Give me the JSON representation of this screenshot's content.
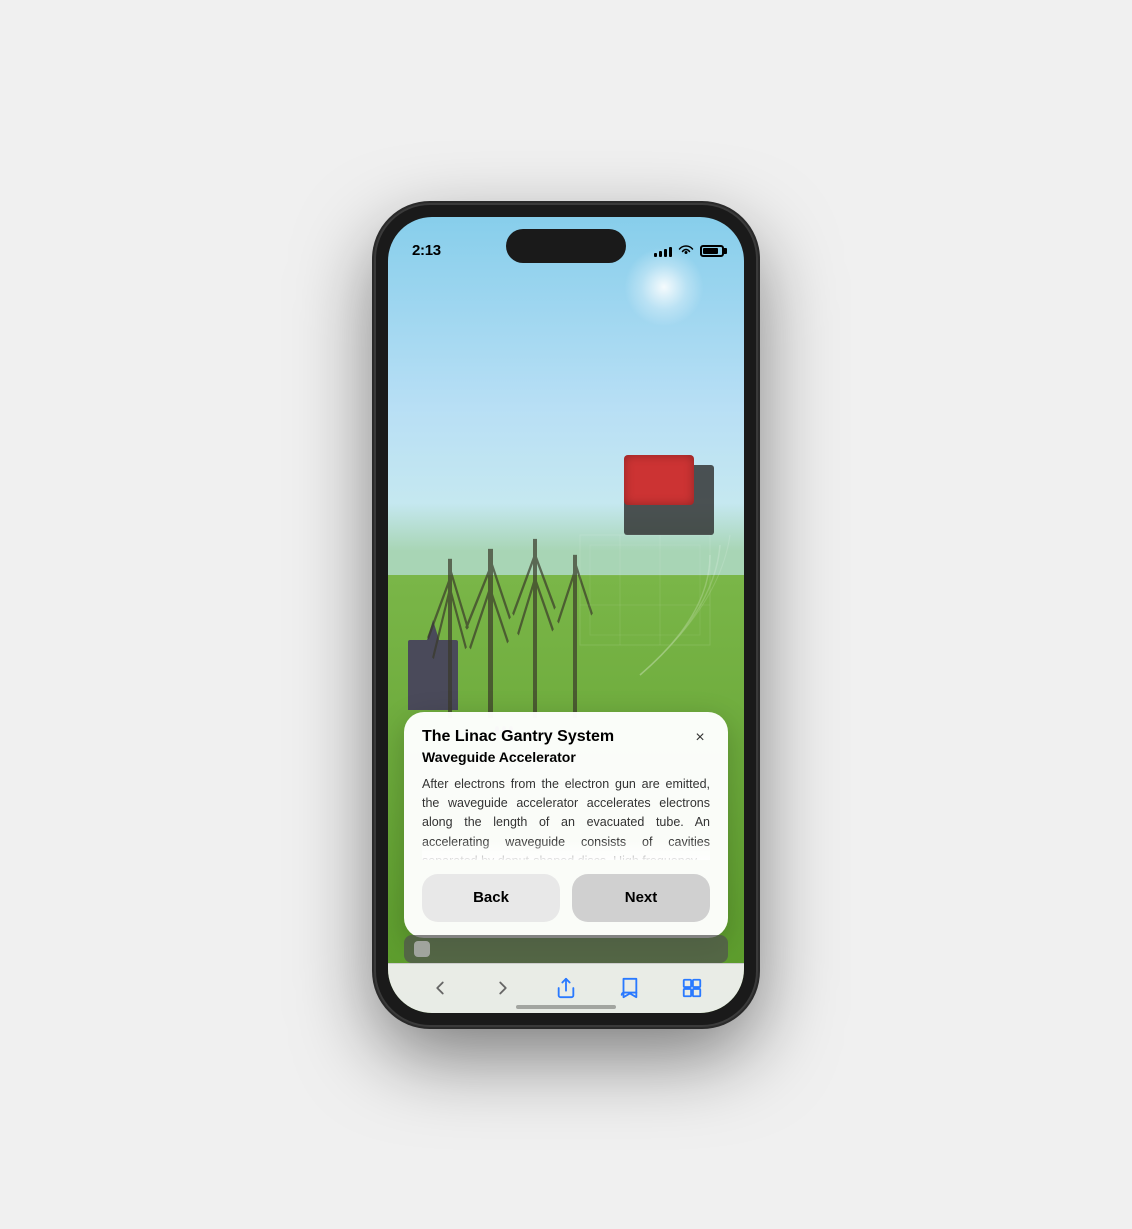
{
  "phone": {
    "status_bar": {
      "time": "2:13",
      "signal_label": "signal",
      "wifi_label": "wifi",
      "battery_label": "battery"
    },
    "ar_scene": {
      "title": "AR Scene",
      "description": "Outdoor AR visualization of Linac Gantry System"
    },
    "info_panel": {
      "title": "The Linac Gantry System",
      "subtitle": "Waveguide Accelerator",
      "body_text": "After electrons from the electron gun are emitted, the waveguide accelerator accelerates electrons along the length of an evacuated tube. An accelerating waveguide consists of cavities separated by donut-shaped discs. High frequency",
      "close_label": "×"
    },
    "nav_buttons": {
      "back_label": "Back",
      "next_label": "Next"
    },
    "browser_toolbar": {
      "back_arrow": "‹",
      "forward_arrow": "›",
      "share_label": "share",
      "bookmarks_label": "bookmarks",
      "tabs_label": "tabs"
    }
  }
}
